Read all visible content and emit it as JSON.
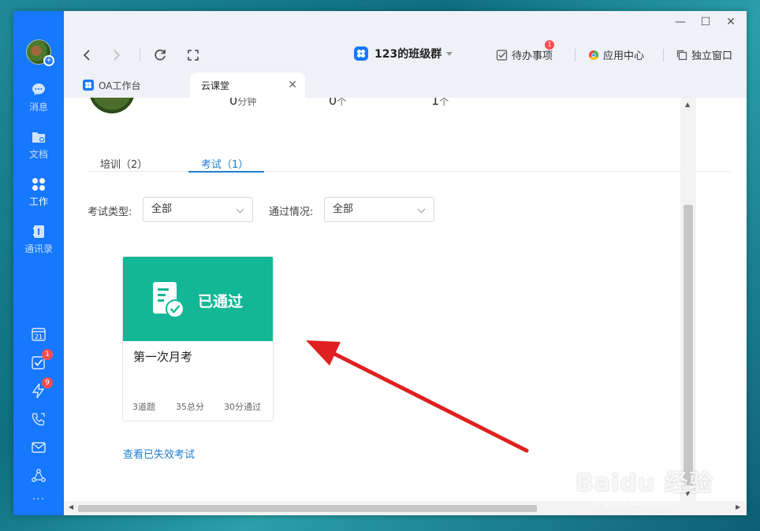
{
  "sidebar": {
    "items": [
      {
        "label": "消息"
      },
      {
        "label": "文档"
      },
      {
        "label": "工作"
      },
      {
        "label": "通讯录"
      }
    ],
    "calendar_day": "21",
    "todo_badge": "1",
    "flash_badge": "9",
    "more": "···"
  },
  "window": {
    "minimize": "—",
    "maximize": "☐",
    "close": "✕"
  },
  "header": {
    "group_title": "123的班级群",
    "actions": {
      "todo": "待办事项",
      "todo_badge": "1",
      "app_center": "应用中心",
      "standalone": "独立窗口"
    }
  },
  "tabs": [
    {
      "label": "OA工作台"
    },
    {
      "label": "云课堂",
      "close": "✕"
    }
  ],
  "stats": {
    "minutes_value": "0",
    "minutes_unit": "分钟",
    "count2_value": "0",
    "count2_unit": "个",
    "count3_value": "1",
    "count3_unit": "个"
  },
  "subtabs": [
    {
      "label": "培训（2）"
    },
    {
      "label": "考试（1）"
    }
  ],
  "filters": {
    "type_label": "考试类型:",
    "type_value": "全部",
    "pass_label": "通过情况:",
    "pass_value": "全部"
  },
  "exam_card": {
    "status": "已通过",
    "title": "第一次月考",
    "questions": "3道题",
    "total": "35总分",
    "pass_score": "30分通过"
  },
  "expired_link": "查看已失效考试",
  "watermark": {
    "main": "Baidu 经验",
    "sub": "jingyan.baidu.com"
  },
  "colors": {
    "rail_blue": "#1677ff",
    "card_green": "#13b795",
    "link_blue": "#1f7fd0",
    "arrow_red": "#e02020"
  }
}
